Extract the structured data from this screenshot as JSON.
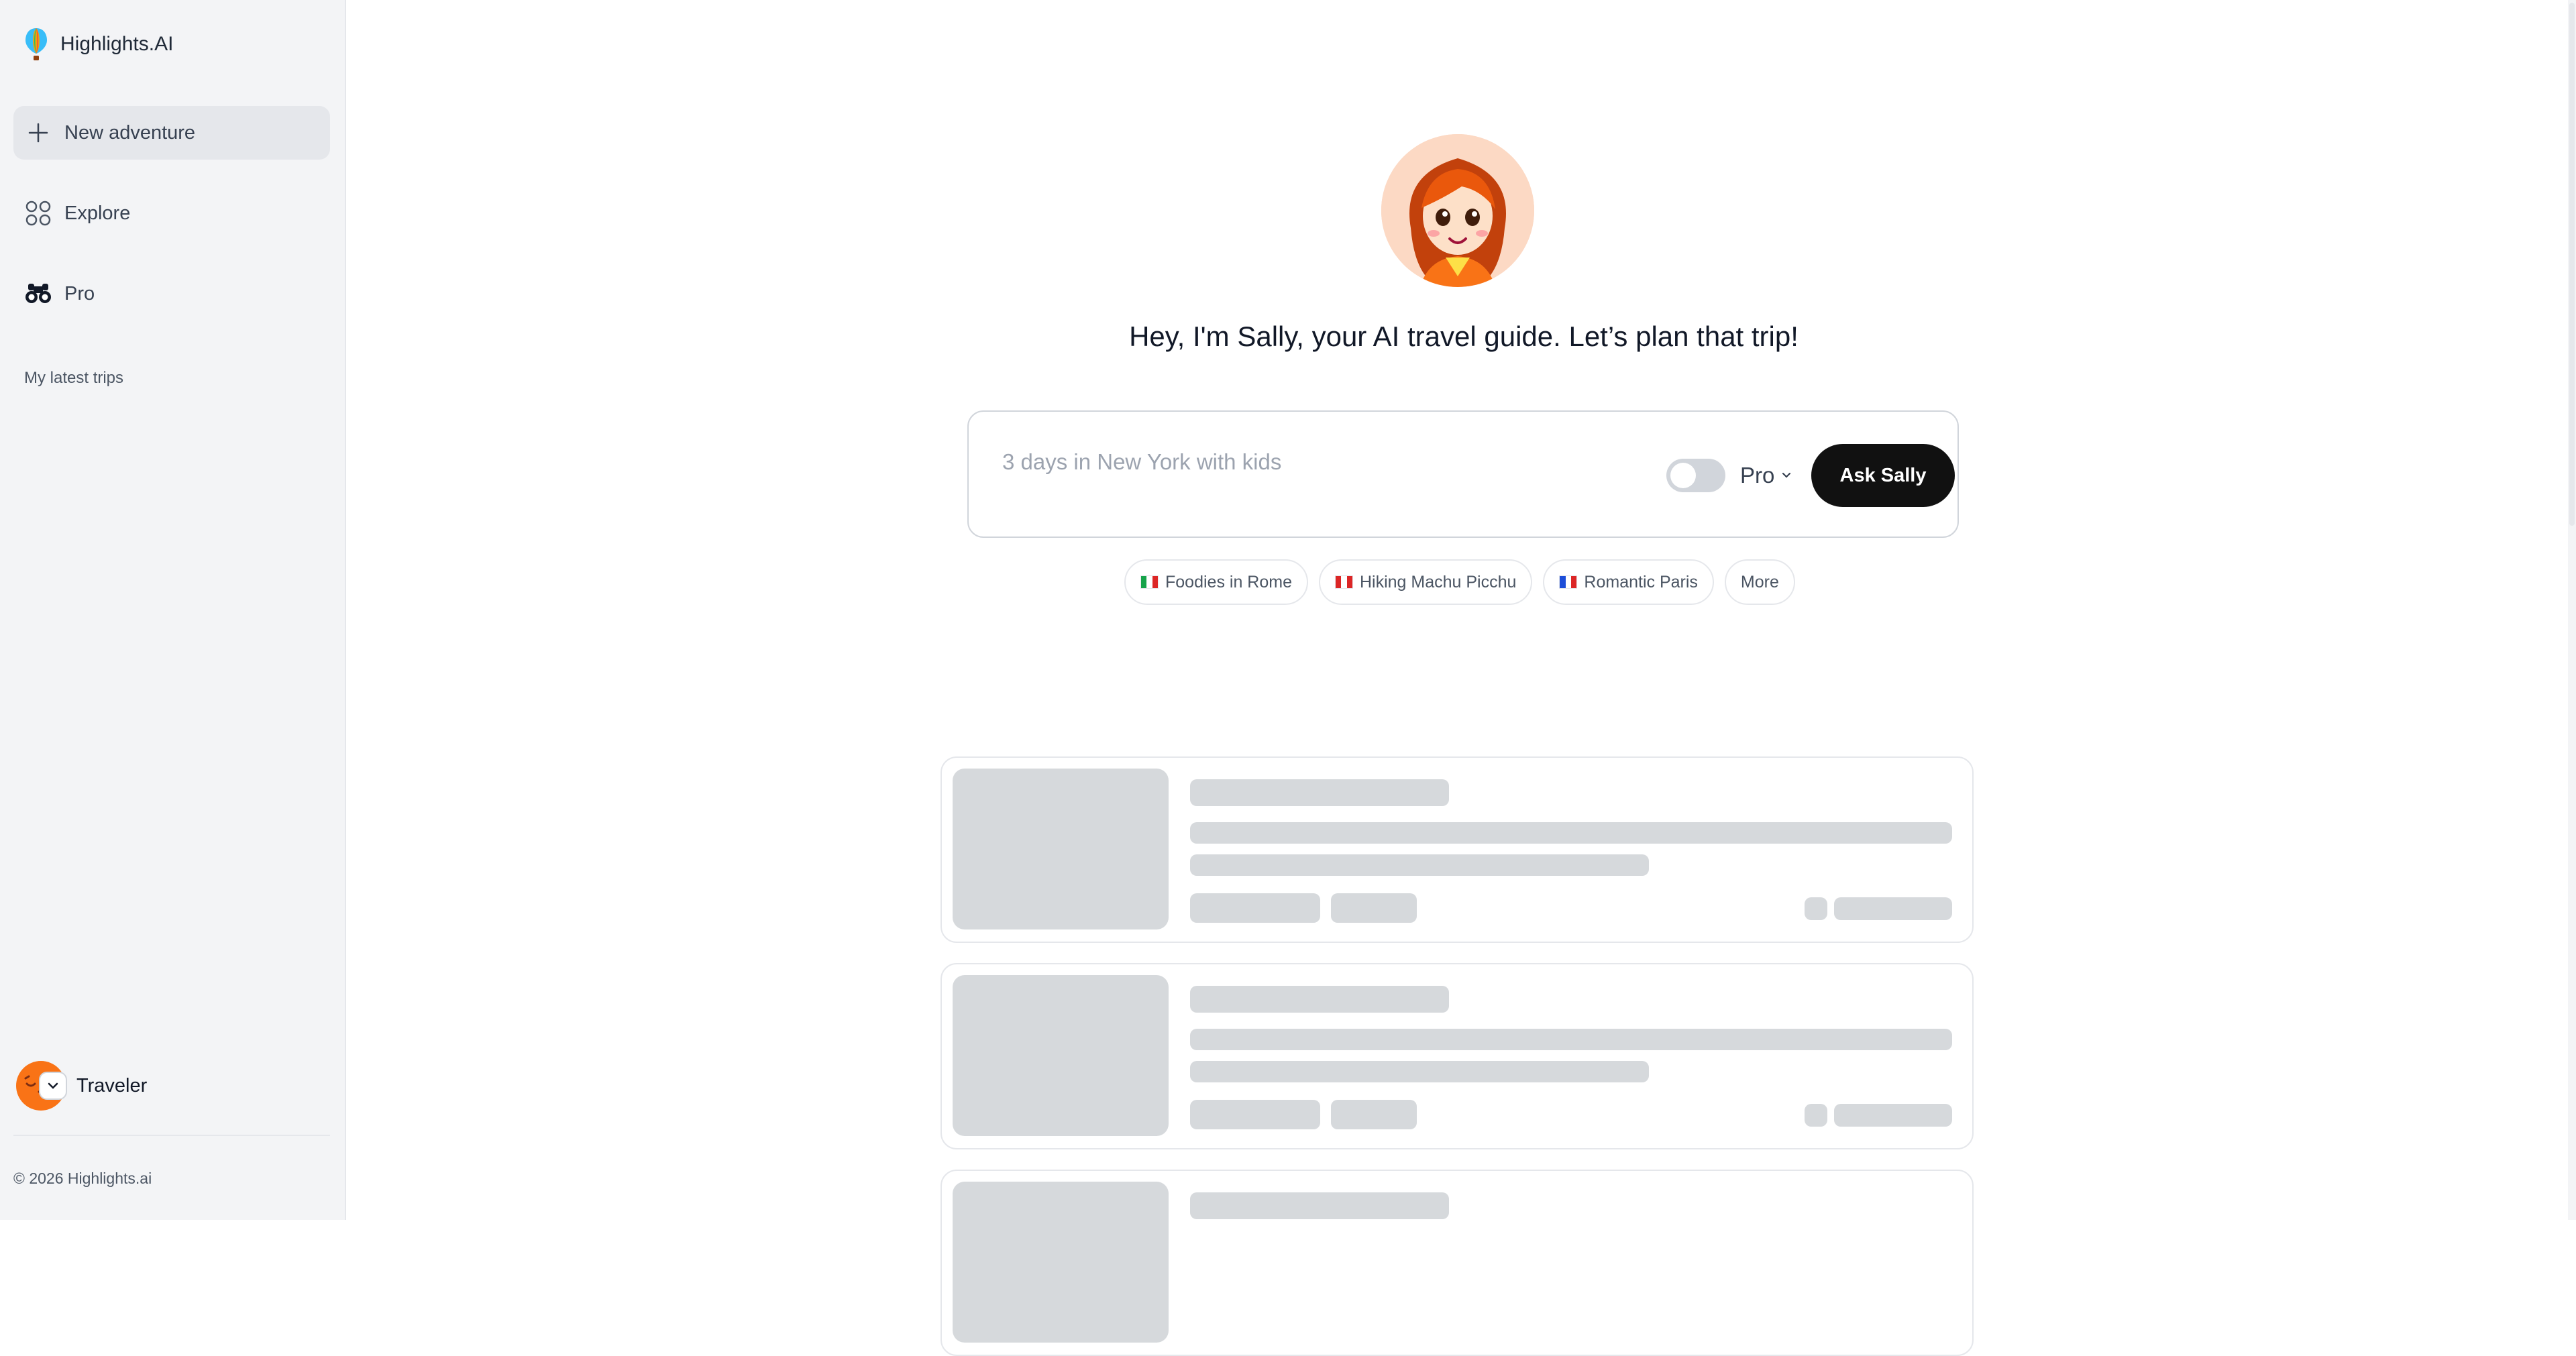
{
  "sidebar": {
    "brand": "Highlights.AI",
    "nav": {
      "new_adventure": "New adventure",
      "explore": "Explore",
      "pro": "Pro"
    },
    "section_label": "My latest trips",
    "user": {
      "name": "Traveler"
    },
    "copyright": "© 2026 Highlights.ai"
  },
  "main": {
    "greeting": "Hey, I'm Sally, your AI travel guide. Let’s plan that trip!",
    "prompt": {
      "placeholder": "3 days in New York with kids",
      "mode_label": "Pro",
      "pro_enabled": false,
      "submit_label": "Ask Sally"
    },
    "suggestions": [
      {
        "label": "Foodies in Rome",
        "flag": "italy-flag"
      },
      {
        "label": "Hiking Machu Picchu",
        "flag": "peru-flag"
      },
      {
        "label": "Romantic Paris",
        "flag": "france-flag"
      }
    ],
    "more_label": "More"
  },
  "colors": {
    "accent": "#111111",
    "sidebar_bg": "#f3f4f6",
    "avatar_orange": "#f97316",
    "skeleton": "#d6d9dc"
  }
}
